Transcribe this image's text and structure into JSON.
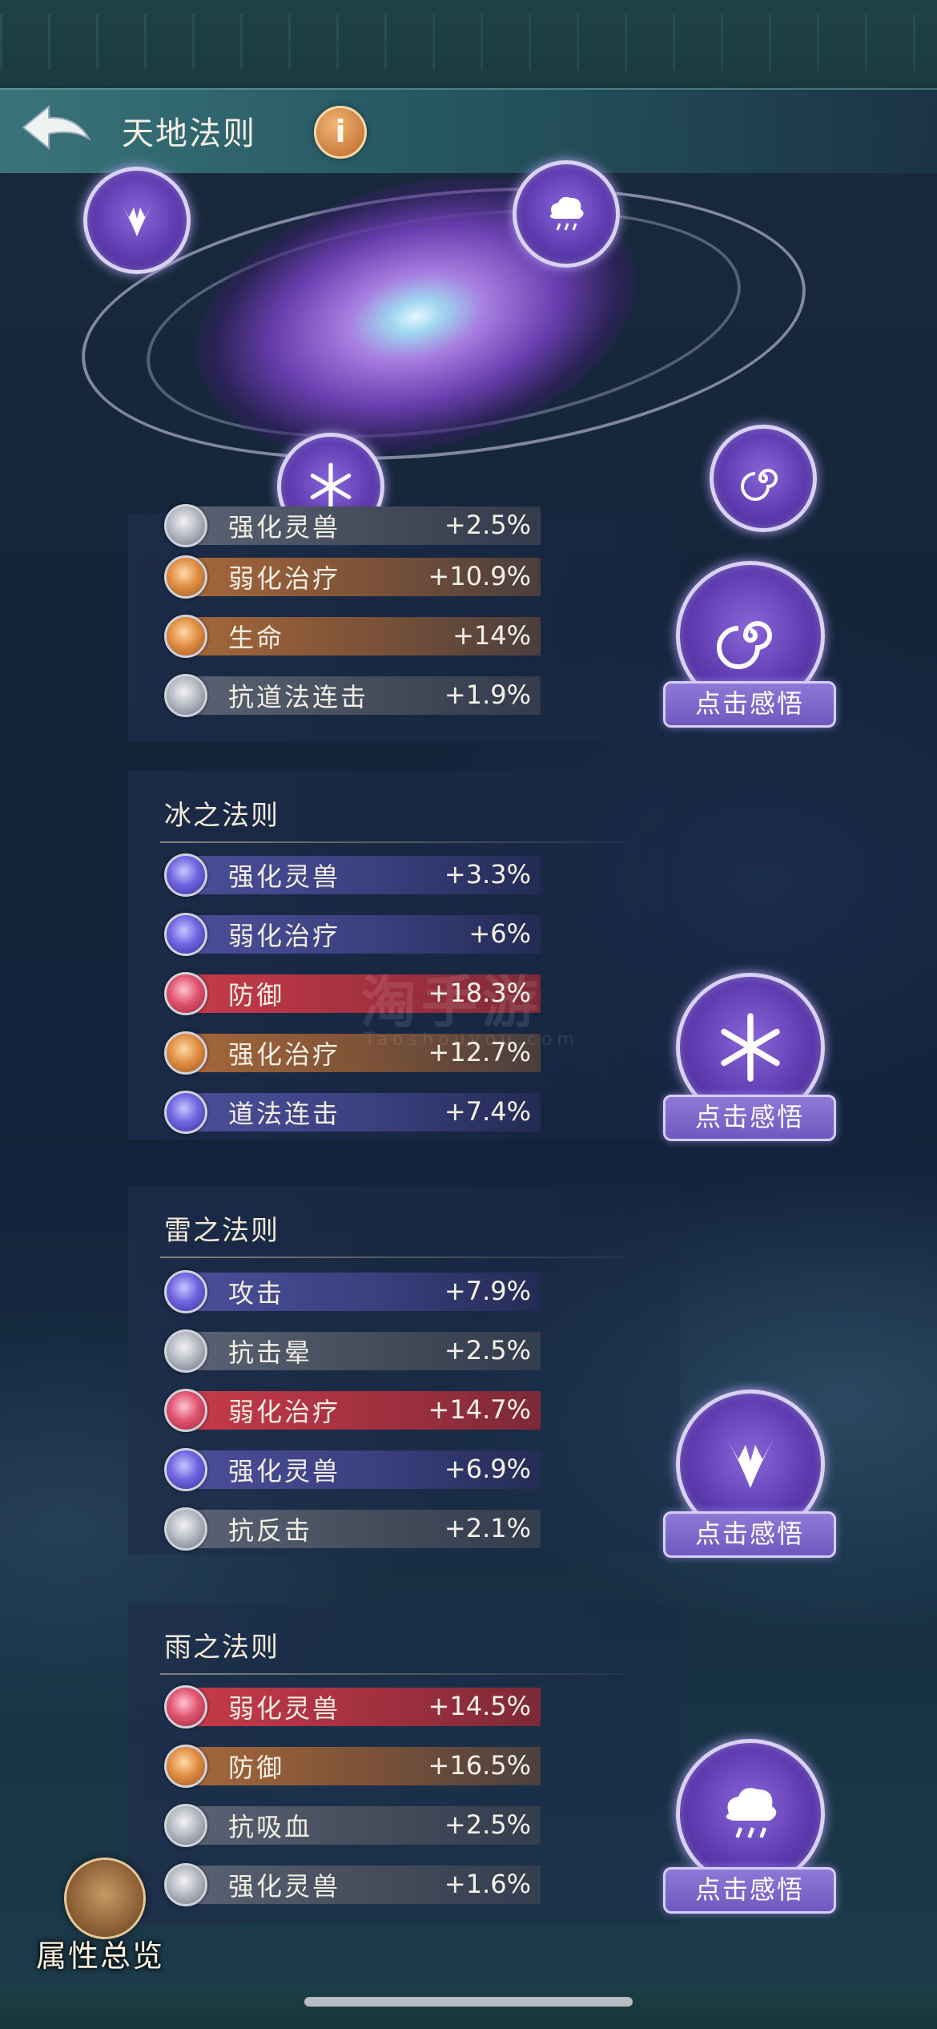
{
  "header": {
    "title": "天地法则",
    "info_label": "i"
  },
  "realize_label": "点击感悟",
  "sections": [
    {
      "title": "",
      "rows": [
        {
          "label": "强化灵兽",
          "value": "+2.5%",
          "color": "grey"
        },
        {
          "label": "弱化治疗",
          "value": "+10.9%",
          "color": "orange"
        },
        {
          "label": "生命",
          "value": "+14%",
          "color": "orange"
        },
        {
          "label": "抗道法连击",
          "value": "+1.9%",
          "color": "grey"
        }
      ]
    },
    {
      "title": "冰之法则",
      "rows": [
        {
          "label": "强化灵兽",
          "value": "+3.3%",
          "color": "blue"
        },
        {
          "label": "弱化治疗",
          "value": "+6%",
          "color": "blue"
        },
        {
          "label": "防御",
          "value": "+18.3%",
          "color": "red"
        },
        {
          "label": "强化治疗",
          "value": "+12.7%",
          "color": "orange"
        },
        {
          "label": "道法连击",
          "value": "+7.4%",
          "color": "blue"
        }
      ]
    },
    {
      "title": "雷之法则",
      "rows": [
        {
          "label": "攻击",
          "value": "+7.9%",
          "color": "blue"
        },
        {
          "label": "抗击晕",
          "value": "+2.5%",
          "color": "grey"
        },
        {
          "label": "弱化治疗",
          "value": "+14.7%",
          "color": "red"
        },
        {
          "label": "强化灵兽",
          "value": "+6.9%",
          "color": "blue"
        },
        {
          "label": "抗反击",
          "value": "+2.1%",
          "color": "grey"
        }
      ]
    },
    {
      "title": "雨之法则",
      "rows": [
        {
          "label": "弱化灵兽",
          "value": "+14.5%",
          "color": "red"
        },
        {
          "label": "防御",
          "value": "+16.5%",
          "color": "orange"
        },
        {
          "label": "抗吸血",
          "value": "+2.5%",
          "color": "grey"
        },
        {
          "label": "强化灵兽",
          "value": "+1.6%",
          "color": "grey"
        }
      ]
    }
  ],
  "watermark": {
    "main": "淘手游",
    "sub": "Taoshouyou.com"
  },
  "overview_label": "属性总览",
  "colors": {
    "accent_purple": "#6e59bf",
    "red_bar": "#c83b4a",
    "orange_bar": "#a7683a",
    "blue_bar": "#4c4f9a",
    "grey_bar": "#5a6374"
  }
}
